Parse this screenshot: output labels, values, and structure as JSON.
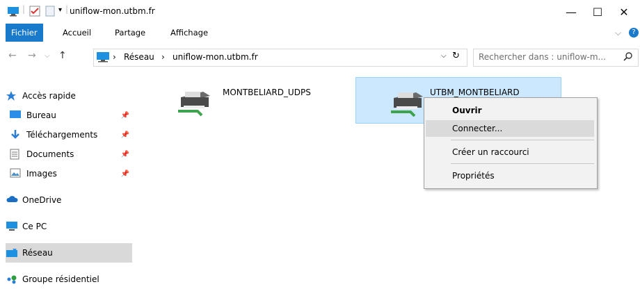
{
  "window": {
    "title": "uniflow-mon.utbm.fr"
  },
  "window_controls": {
    "minimize": "—",
    "maximize": "☐",
    "close": "✕"
  },
  "ribbon": {
    "tabs": [
      "Fichier",
      "Accueil",
      "Partage",
      "Affichage"
    ]
  },
  "address": {
    "path": [
      "Réseau",
      "uniflow-mon.utbm.fr"
    ],
    "search_placeholder": "Rechercher dans : uniflow-m..."
  },
  "sidebar": {
    "quick_access": "Accès rapide",
    "pinned": [
      "Bureau",
      "Téléchargements",
      "Documents",
      "Images"
    ],
    "onedrive": "OneDrive",
    "this_pc": "Ce PC",
    "network": "Réseau",
    "homegroup": "Groupe résidentiel"
  },
  "content": {
    "items": [
      "MONTBELIARD_UDPS",
      "UTBM_MONTBELIARD"
    ]
  },
  "context_menu": {
    "open": "Ouvrir",
    "connect": "Connecter...",
    "create_shortcut": "Créer un raccourci",
    "properties": "Propriétés"
  },
  "colors": {
    "accent": "#1979ca",
    "selection": "#cce8ff",
    "selection_border": "#99d1ff",
    "menu_hover": "#dadada"
  }
}
